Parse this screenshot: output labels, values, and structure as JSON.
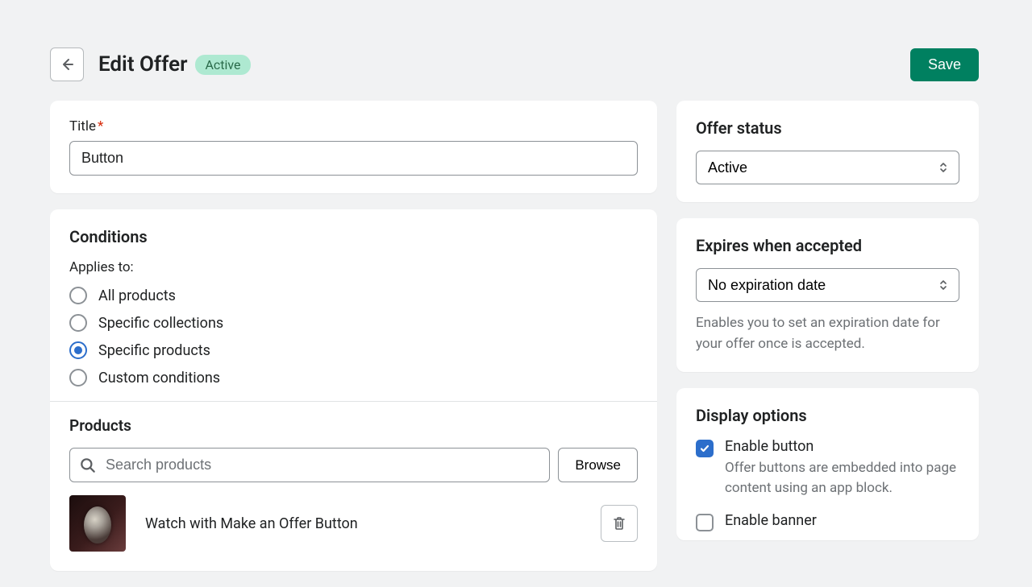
{
  "header": {
    "title": "Edit Offer",
    "badge": "Active",
    "save_label": "Save"
  },
  "title_card": {
    "label": "Title",
    "value": "Button"
  },
  "conditions": {
    "heading": "Conditions",
    "applies_to_label": "Applies to:",
    "options": [
      {
        "label": "All products",
        "selected": false
      },
      {
        "label": "Specific collections",
        "selected": false
      },
      {
        "label": "Specific products",
        "selected": true
      },
      {
        "label": "Custom conditions",
        "selected": false
      }
    ]
  },
  "products": {
    "heading": "Products",
    "search_placeholder": "Search products",
    "browse_label": "Browse",
    "items": [
      {
        "name": "Watch with Make an Offer Button"
      }
    ]
  },
  "sidebar": {
    "status": {
      "heading": "Offer status",
      "value": "Active"
    },
    "expires": {
      "heading": "Expires when accepted",
      "value": "No expiration date",
      "help": "Enables you to set an expiration date for your offer once is accepted."
    },
    "display": {
      "heading": "Display options",
      "enable_button": {
        "label": "Enable button",
        "desc": "Offer buttons are embedded into page content using an app block.",
        "checked": true
      },
      "enable_banner": {
        "label": "Enable banner",
        "checked": false
      }
    }
  }
}
